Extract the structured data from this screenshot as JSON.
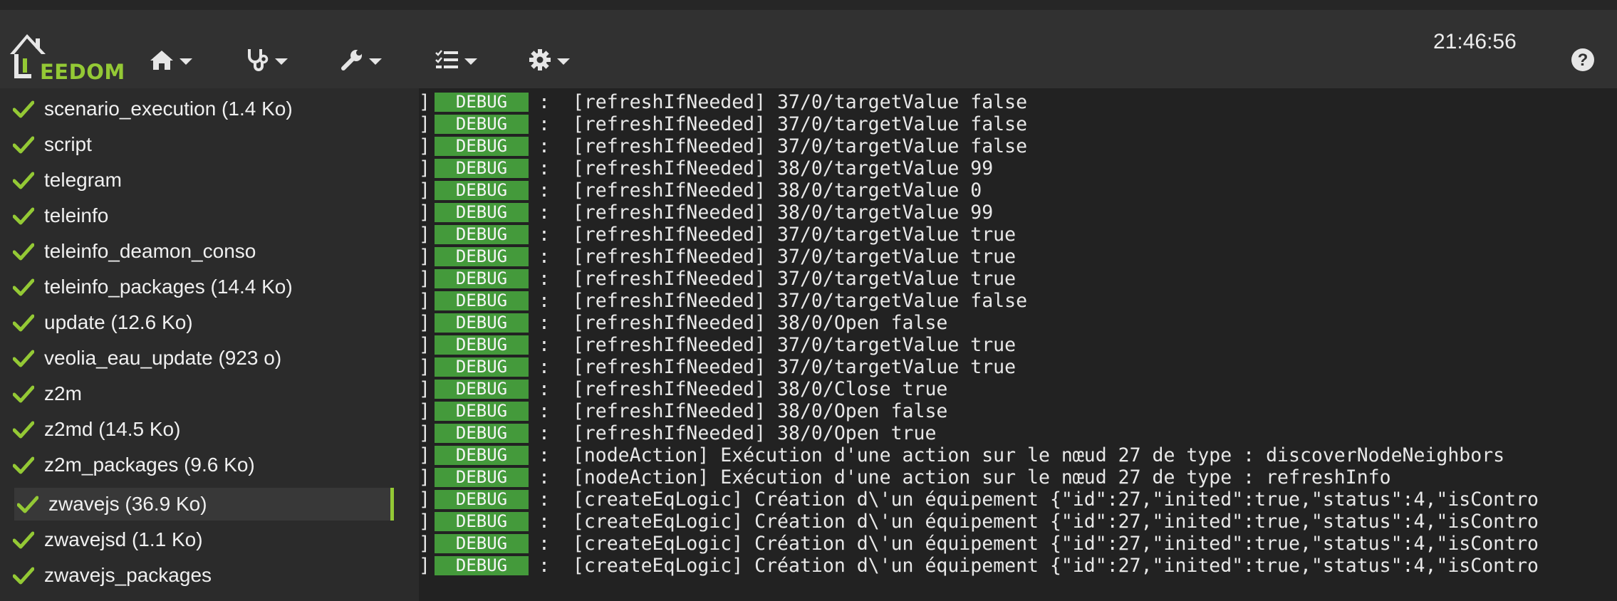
{
  "header": {
    "logo_text": "EEDOM",
    "clock": "21:46:56",
    "help_icon": "question-circle-icon",
    "nav": [
      {
        "icon": "home-icon"
      },
      {
        "icon": "stethoscope-icon"
      },
      {
        "icon": "wrench-icon"
      },
      {
        "icon": "tasks-icon"
      },
      {
        "icon": "gear-icon"
      }
    ],
    "accent_color": "#94c935"
  },
  "sidebar": {
    "items": [
      {
        "label": "scenario_execution (1.4 Ko)"
      },
      {
        "label": "script"
      },
      {
        "label": "telegram"
      },
      {
        "label": "teleinfo"
      },
      {
        "label": "teleinfo_deamon_conso"
      },
      {
        "label": "teleinfo_packages (14.4 Ko)"
      },
      {
        "label": "update (12.6 Ko)"
      },
      {
        "label": "veolia_eau_update (923 o)"
      },
      {
        "label": "z2m"
      },
      {
        "label": "z2md (14.5 Ko)"
      },
      {
        "label": "z2m_packages (9.6 Ko)"
      },
      {
        "label": "zwavejs (36.9 Ko)",
        "active": true
      },
      {
        "label": "zwavejsd (1.1 Ko)"
      },
      {
        "label": "zwavejs_packages"
      }
    ]
  },
  "log": {
    "bracket": "]",
    "level": "DEBUG",
    "badge_color": "#449a3b",
    "lines": [
      ":  [refreshIfNeeded] 37/0/targetValue false",
      ":  [refreshIfNeeded] 37/0/targetValue false",
      ":  [refreshIfNeeded] 37/0/targetValue false",
      ":  [refreshIfNeeded] 38/0/targetValue 99",
      ":  [refreshIfNeeded] 38/0/targetValue 0",
      ":  [refreshIfNeeded] 38/0/targetValue 99",
      ":  [refreshIfNeeded] 37/0/targetValue true",
      ":  [refreshIfNeeded] 37/0/targetValue true",
      ":  [refreshIfNeeded] 37/0/targetValue true",
      ":  [refreshIfNeeded] 37/0/targetValue false",
      ":  [refreshIfNeeded] 38/0/Open false",
      ":  [refreshIfNeeded] 37/0/targetValue true",
      ":  [refreshIfNeeded] 37/0/targetValue true",
      ":  [refreshIfNeeded] 38/0/Close true",
      ":  [refreshIfNeeded] 38/0/Open false",
      ":  [refreshIfNeeded] 38/0/Open true",
      ":  [nodeAction] Exécution d'une action sur le nœud 27 de type : discoverNodeNeighbors",
      ":  [nodeAction] Exécution d'une action sur le nœud 27 de type : refreshInfo",
      ":  [createEqLogic] Création d\\'un équipement {\"id\":27,\"inited\":true,\"status\":4,\"isContro",
      ":  [createEqLogic] Création d\\'un équipement {\"id\":27,\"inited\":true,\"status\":4,\"isContro",
      ":  [createEqLogic] Création d\\'un équipement {\"id\":27,\"inited\":true,\"status\":4,\"isContro",
      ":  [createEqLogic] Création d\\'un équipement {\"id\":27,\"inited\":true,\"status\":4,\"isContro"
    ]
  }
}
